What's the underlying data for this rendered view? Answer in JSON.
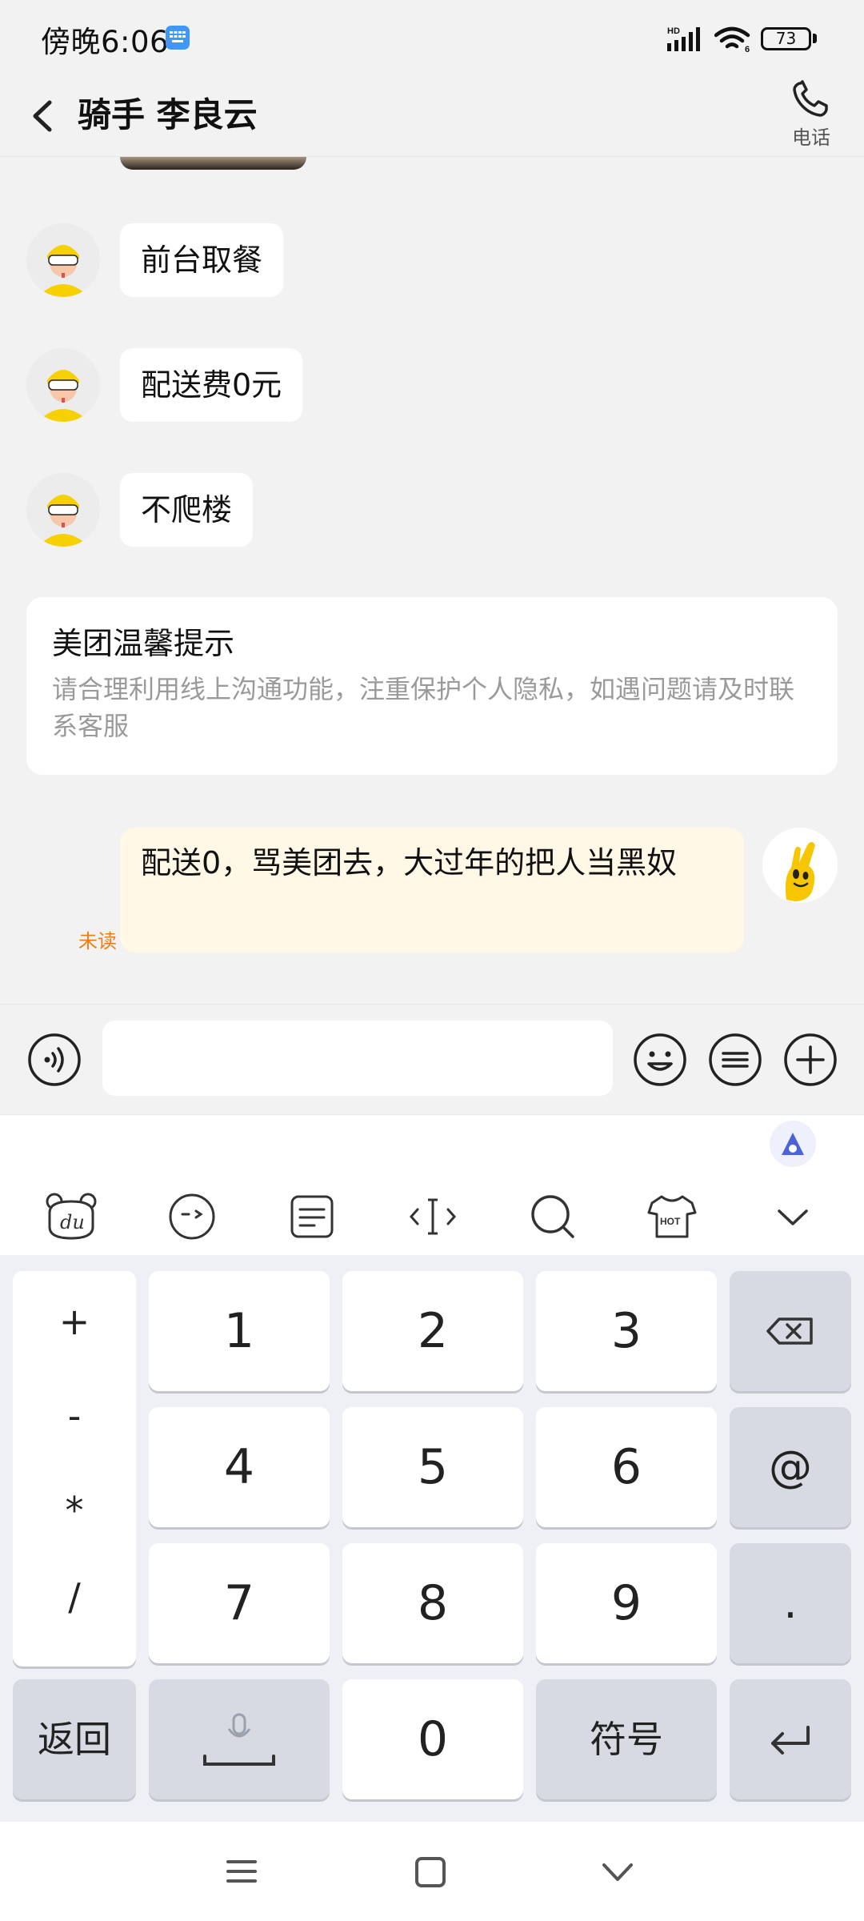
{
  "status_bar": {
    "time": "傍晚6:06",
    "network_label": "HD",
    "wifi_label": "6",
    "battery": "73"
  },
  "header": {
    "title": "骑手 李良云",
    "phone_label": "电话"
  },
  "messages": [
    {
      "sender": "rider",
      "text": "前台取餐"
    },
    {
      "sender": "rider",
      "text": "配送费0元"
    },
    {
      "sender": "rider",
      "text": "不爬楼"
    }
  ],
  "tip_card": {
    "title": "美团温馨提示",
    "body": "请合理利用线上沟通功能，注重保护个人隐私，如遇问题请及时联系客服"
  },
  "self_message": {
    "text": "配送0，骂美团去，大过年的把人当黑奴",
    "status": "未读"
  },
  "input": {
    "value": "",
    "placeholder": ""
  },
  "keyboard": {
    "toolbar_icons": [
      "du-bear-icon",
      "wink-face-icon",
      "clipboard-icon",
      "cursor-icon",
      "search-icon",
      "hot-shirt-icon",
      "collapse-icon"
    ],
    "toolbar_hot_label": "HOT",
    "symbols": [
      "+",
      "-",
      "*",
      "/"
    ],
    "keys": [
      "1",
      "2",
      "3",
      "4",
      "5",
      "6",
      "7",
      "8",
      "9",
      "0"
    ],
    "at": "@",
    "dot": ".",
    "back": "返回",
    "symbol_key": "符号"
  },
  "colors": {
    "accent_orange": "#ef7d12",
    "self_bubble": "#fff8e6",
    "background": "#f2f2f2"
  }
}
